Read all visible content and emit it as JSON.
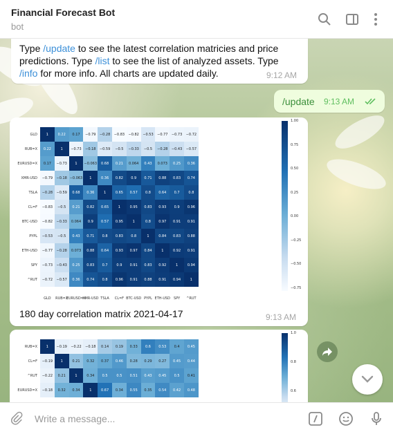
{
  "header": {
    "title": "Financial Forecast Bot",
    "subtitle": "bot",
    "icons": [
      "search-icon",
      "sidebar-icon",
      "more-vertical-icon"
    ]
  },
  "messages": {
    "intro": {
      "text_1": "Type ",
      "link_update": "/update",
      "text_2": " to see the latest correlation matricies and price predictions. Type ",
      "link_list": "/list",
      "text_3": " to see the list of analyzed assets. Type ",
      "link_info": "/info",
      "text_4": " for more info. All charts are updated daily.",
      "time": "9:12 AM"
    },
    "outgoing": {
      "text": "/update",
      "time": "9:13 AM"
    },
    "chart1": {
      "caption": "180 day correlation matrix 2021-04-17",
      "time": "9:13 AM"
    }
  },
  "chart_data": [
    {
      "type": "heatmap",
      "labels": [
        "GLD",
        "RUB=X",
        "EURUSD=X",
        "XMR-USD",
        "TSLA",
        "CL=F",
        "BTC-USD",
        "PYPL",
        "ETH-USD",
        "SPY",
        "^RUT"
      ],
      "values": [
        [
          1,
          0.22,
          0.17,
          -0.79,
          -0.28,
          -0.83,
          -0.82,
          -0.53,
          -0.77,
          -0.73,
          -0.72
        ],
        [
          0.22,
          1,
          -0.73,
          -0.18,
          -0.59,
          -0.5,
          -0.33,
          -0.5,
          -0.28,
          -0.43,
          -0.57
        ],
        [
          0.17,
          -0.73,
          1,
          -0.063,
          0.68,
          0.21,
          0.064,
          0.43,
          0.073,
          0.25,
          0.36
        ],
        [
          -0.79,
          -0.18,
          -0.063,
          1,
          0.36,
          0.82,
          0.9,
          0.71,
          0.88,
          0.83,
          0.74
        ],
        [
          -0.28,
          -0.59,
          0.68,
          0.36,
          1,
          0.65,
          0.57,
          0.8,
          0.64,
          0.7,
          0.8
        ],
        [
          -0.83,
          -0.5,
          0.21,
          0.82,
          0.65,
          1,
          0.95,
          0.83,
          0.93,
          0.9,
          0.96
        ],
        [
          -0.82,
          -0.33,
          0.064,
          0.9,
          0.57,
          0.95,
          1,
          0.8,
          0.97,
          0.91,
          0.91
        ],
        [
          -0.53,
          -0.5,
          0.43,
          0.71,
          0.8,
          0.83,
          0.8,
          1,
          0.84,
          0.83,
          0.88
        ],
        [
          -0.77,
          -0.28,
          0.073,
          0.88,
          0.64,
          0.93,
          0.97,
          0.84,
          1,
          0.92,
          0.91
        ],
        [
          -0.73,
          -0.43,
          0.25,
          0.83,
          0.7,
          0.9,
          0.91,
          0.83,
          0.92,
          1,
          0.94
        ],
        [
          -0.72,
          -0.57,
          0.36,
          0.74,
          0.8,
          0.96,
          0.91,
          0.88,
          0.91,
          0.94,
          1
        ]
      ],
      "colorbar_ticks": [
        "1.00",
        "0.75",
        "0.50",
        "0.25",
        "0.00",
        "−0.25",
        "−0.50",
        "−0.75"
      ],
      "colorbar_range": [
        -0.83,
        1
      ]
    },
    {
      "type": "heatmap",
      "row_labels": [
        "RUB=X",
        "CL=F",
        "^RUT",
        "EURUSD=X"
      ],
      "values": [
        [
          1,
          -0.19,
          -0.22,
          -0.18,
          0.14,
          0.19,
          0.33,
          0.6,
          0.53,
          0.4,
          0.45
        ],
        [
          -0.19,
          1,
          0.21,
          0.32,
          0.37,
          0.46,
          0.28,
          0.29,
          0.27,
          0.45,
          0.44
        ],
        [
          -0.22,
          0.21,
          1,
          0.34,
          0.5,
          0.5,
          0.51,
          0.43,
          0.45,
          0.5,
          0.41
        ],
        [
          -0.18,
          0.32,
          0.34,
          1,
          0.67,
          0.34,
          0.55,
          0.35,
          0.54,
          0.42,
          0.48
        ]
      ],
      "colorbar_ticks": [
        "1.0",
        "0.8",
        "0.6"
      ],
      "colorbar_range": [
        -0.3,
        1
      ]
    }
  ],
  "composer": {
    "placeholder": "Write a message...",
    "icons": [
      "attach-icon",
      "command-icon",
      "emoji-icon",
      "microphone-icon"
    ]
  }
}
